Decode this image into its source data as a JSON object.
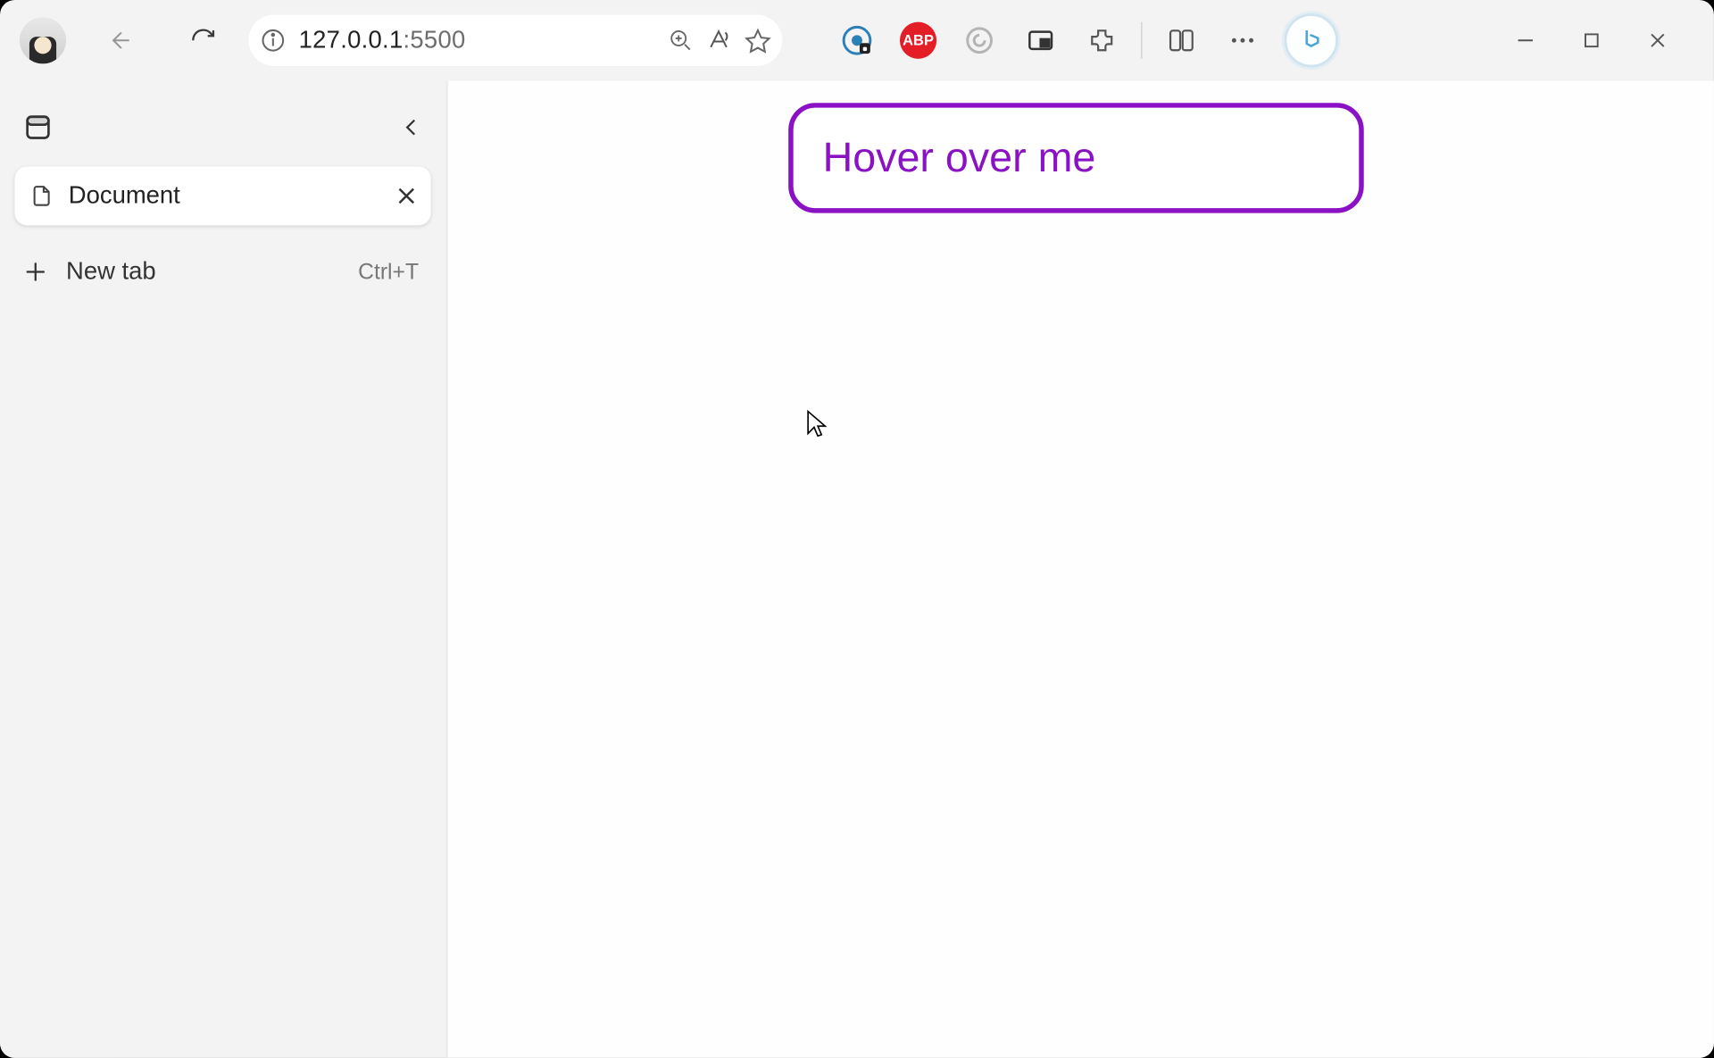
{
  "address_bar": {
    "host": "127.0.0.1",
    "port": ":5500"
  },
  "sidebar": {
    "tab": {
      "title": "Document"
    },
    "new_tab": {
      "label": "New tab",
      "shortcut": "Ctrl+T"
    }
  },
  "toolbar_ext": {
    "abp": "ABP"
  },
  "page": {
    "hover_text": "Hover over me"
  }
}
